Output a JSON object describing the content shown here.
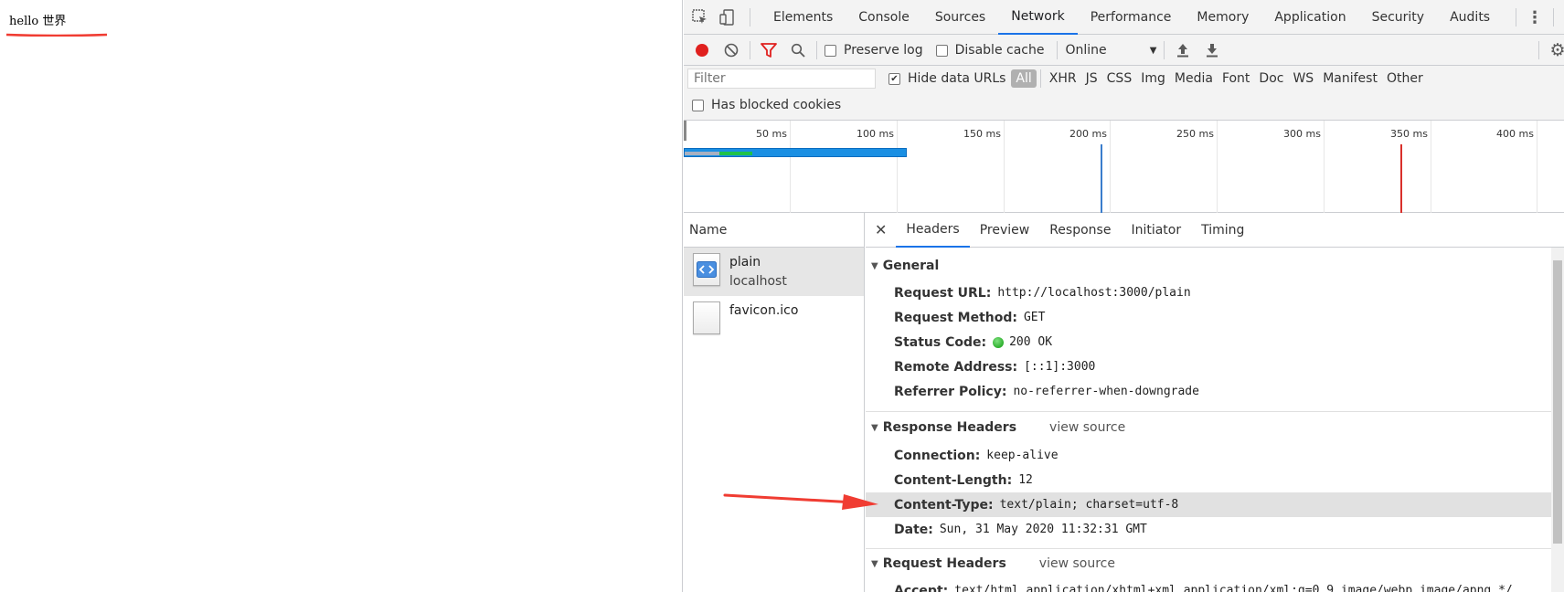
{
  "page": {
    "body_text": "hello 世界"
  },
  "devtools": {
    "main_tabs": [
      "Elements",
      "Console",
      "Sources",
      "Network",
      "Performance",
      "Memory",
      "Application",
      "Security",
      "Audits"
    ],
    "active_main_tab": "Network",
    "toolbar": {
      "preserve_log": "Preserve log",
      "disable_cache": "Disable cache",
      "throttle": "Online"
    },
    "filter": {
      "placeholder": "Filter",
      "hide_data_urls": "Hide data URLs",
      "types": [
        "All",
        "XHR",
        "JS",
        "CSS",
        "Img",
        "Media",
        "Font",
        "Doc",
        "WS",
        "Manifest",
        "Other"
      ],
      "has_blocked_cookies": "Has blocked cookies"
    },
    "timeline": {
      "ticks": [
        "50 ms",
        "100 ms",
        "150 ms",
        "200 ms",
        "250 ms",
        "300 ms",
        "350 ms",
        "400 ms"
      ]
    },
    "requests": {
      "header": "Name",
      "items": [
        {
          "name": "plain",
          "sub": "localhost"
        },
        {
          "name": "favicon.ico",
          "sub": ""
        }
      ]
    },
    "detail_tabs": [
      "Headers",
      "Preview",
      "Response",
      "Initiator",
      "Timing"
    ],
    "general": {
      "title": "General",
      "rows": [
        {
          "key": "Request URL:",
          "value": "http://localhost:3000/plain"
        },
        {
          "key": "Request Method:",
          "value": "GET"
        },
        {
          "key": "Status Code:",
          "value": "200 OK"
        },
        {
          "key": "Remote Address:",
          "value": "[::1]:3000"
        },
        {
          "key": "Referrer Policy:",
          "value": "no-referrer-when-downgrade"
        }
      ]
    },
    "response_headers": {
      "title": "Response Headers",
      "view_source": "view source",
      "rows": [
        {
          "key": "Connection:",
          "value": "keep-alive"
        },
        {
          "key": "Content-Length:",
          "value": "12"
        },
        {
          "key": "Content-Type:",
          "value": "text/plain; charset=utf-8"
        },
        {
          "key": "Date:",
          "value": "Sun, 31 May 2020 11:32:31 GMT"
        }
      ]
    },
    "request_headers": {
      "title": "Request Headers",
      "view_source": "view source",
      "rows": [
        {
          "key": "Accept:",
          "value": "text/html,application/xhtml+xml,application/xml;q=0.9,image/webp,image/apng,*/"
        }
      ]
    }
  },
  "colors": {
    "accent": "#1a73e8",
    "record": "#e0201e",
    "annotation_red": "#f03c32",
    "status_green": "#0a9a0a"
  }
}
